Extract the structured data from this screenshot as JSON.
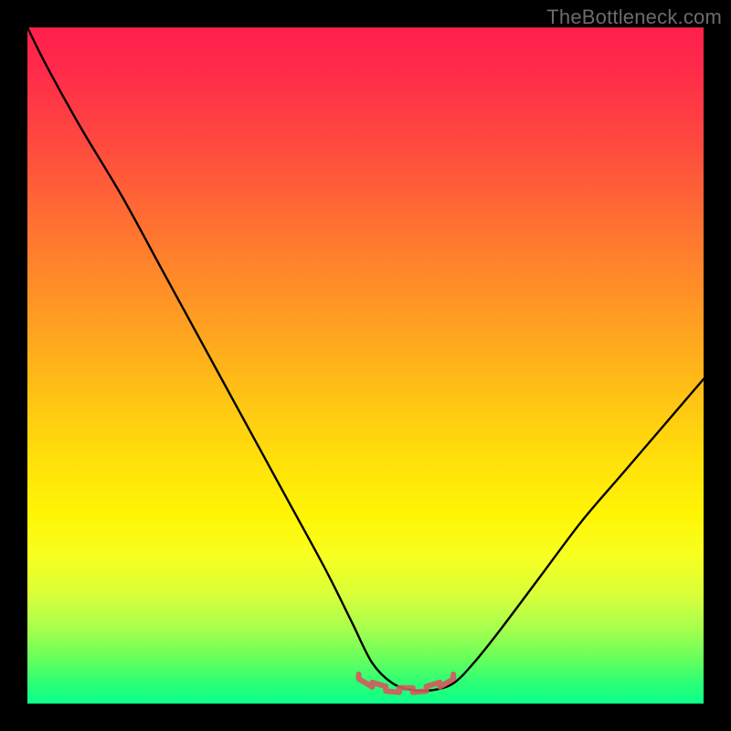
{
  "watermark": "TheBottleneck.com",
  "chart_data": {
    "type": "line",
    "title": "",
    "xlabel": "",
    "ylabel": "",
    "xlim": [
      0,
      100
    ],
    "ylim": [
      0,
      100
    ],
    "gradient_stops": [
      {
        "pct": 0,
        "color": "#ff1f4b"
      },
      {
        "pct": 6,
        "color": "#ff2a4a"
      },
      {
        "pct": 18,
        "color": "#ff4c3e"
      },
      {
        "pct": 32,
        "color": "#ff7a2f"
      },
      {
        "pct": 45,
        "color": "#ffa320"
      },
      {
        "pct": 55,
        "color": "#ffc414"
      },
      {
        "pct": 64,
        "color": "#ffe00a"
      },
      {
        "pct": 72,
        "color": "#fff506"
      },
      {
        "pct": 78,
        "color": "#f8ff1f"
      },
      {
        "pct": 84,
        "color": "#d8ff3a"
      },
      {
        "pct": 89,
        "color": "#a6ff4e"
      },
      {
        "pct": 93,
        "color": "#6cff5a"
      },
      {
        "pct": 97,
        "color": "#2bff76"
      },
      {
        "pct": 100,
        "color": "#0cff8a"
      }
    ],
    "curve": {
      "description": "V-shaped notch curve with a flattened saddle near the bottom; left slope enters from the top-left, descends steeply to a broad minimum around x≈52–62 at y≈2, then rises more gently to exit mid-right edge at y≈48.",
      "x": [
        0,
        3,
        8,
        14,
        20,
        26,
        32,
        38,
        44,
        48,
        51,
        54,
        57,
        60,
        63,
        66,
        70,
        76,
        82,
        88,
        94,
        100
      ],
      "y": [
        100,
        94,
        85,
        75,
        64,
        53,
        42,
        31,
        20,
        12,
        6,
        3,
        2,
        2,
        3,
        6,
        11,
        19,
        27,
        34,
        41,
        48
      ]
    },
    "saddle_marker": {
      "description": "Short reddish scribble highlighting the flattened minimum of the curve.",
      "color": "#d7585c",
      "x": [
        49,
        51,
        53,
        55,
        57,
        59,
        61,
        63
      ],
      "y": [
        4.0,
        2.8,
        2.2,
        2.0,
        2.0,
        2.2,
        2.8,
        4.0
      ]
    }
  }
}
